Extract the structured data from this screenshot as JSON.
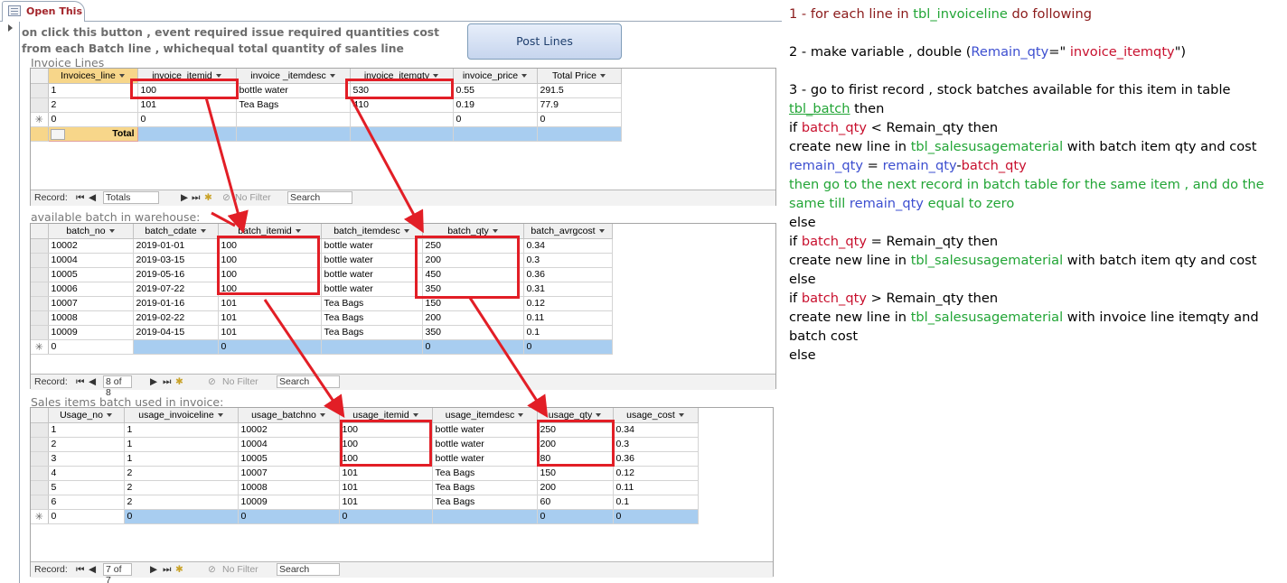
{
  "tab": {
    "label": "Open This"
  },
  "note": {
    "text": "on click this button , event required issue required quantities cost from each Batch line , whichequal total quantity of sales line"
  },
  "post_button": {
    "label": "Post Lines"
  },
  "invoice_lines": {
    "caption": "Invoice Lines",
    "columns": [
      "Invoices_line",
      "invoice_itemid",
      "invoice _itemdesc",
      "invoice_itemqty",
      "invoice_price",
      "Total Price"
    ],
    "rows": [
      [
        "1",
        "100",
        "bottle water",
        "530",
        "0.55",
        "291.5"
      ],
      [
        "2",
        "101",
        "Tea Bags",
        "410",
        "0.19",
        "77.9"
      ]
    ],
    "new_row": [
      "0",
      "0",
      "",
      "",
      "0",
      "0"
    ],
    "total_label": "Total",
    "nav": {
      "record_label": "Record:",
      "position": "Totals",
      "filter": "No Filter",
      "search": "Search"
    }
  },
  "batch": {
    "caption": "available batch in warehouse:",
    "columns": [
      "batch_no",
      "batch_cdate",
      "batch_itemid",
      "batch_itemdesc",
      "batch_qty",
      "batch_avrgcost"
    ],
    "rows": [
      [
        "10002",
        "2019-01-01",
        "100",
        "bottle water",
        "250",
        "0.34"
      ],
      [
        "10004",
        "2019-03-15",
        "100",
        "bottle water",
        "200",
        "0.3"
      ],
      [
        "10005",
        "2019-05-16",
        "100",
        "bottle water",
        "450",
        "0.36"
      ],
      [
        "10006",
        "2019-07-22",
        "100",
        "bottle water",
        "350",
        "0.31"
      ],
      [
        "10007",
        "2019-01-16",
        "101",
        "Tea Bags",
        "150",
        "0.12"
      ],
      [
        "10008",
        "2019-02-22",
        "101",
        "Tea Bags",
        "200",
        "0.11"
      ],
      [
        "10009",
        "2019-04-15",
        "101",
        "Tea Bags",
        "350",
        "0.1"
      ]
    ],
    "new_row": [
      "0",
      "",
      "0",
      "",
      "0",
      "0"
    ],
    "nav": {
      "record_label": "Record:",
      "position": "8 of 8",
      "filter": "No Filter",
      "search": "Search"
    }
  },
  "usage": {
    "caption": "Sales items batch used in invoice:",
    "columns": [
      "Usage_no",
      "usage_invoiceline",
      "usage_batchno",
      "usage_itemid",
      "usage_itemdesc",
      "usage_qty",
      "usage_cost"
    ],
    "rows": [
      [
        "1",
        "1",
        "10002",
        "100",
        "bottle water",
        "250",
        "0.34"
      ],
      [
        "2",
        "1",
        "10004",
        "100",
        "bottle water",
        "200",
        "0.3"
      ],
      [
        "3",
        "1",
        "10005",
        "100",
        "bottle water",
        "80",
        "0.36"
      ],
      [
        "4",
        "2",
        "10007",
        "101",
        "Tea Bags",
        "150",
        "0.12"
      ],
      [
        "5",
        "2",
        "10008",
        "101",
        "Tea Bags",
        "200",
        "0.11"
      ],
      [
        "6",
        "2",
        "10009",
        "101",
        "Tea Bags",
        "60",
        "0.1"
      ]
    ],
    "new_row": [
      "0",
      "0",
      "0",
      "0",
      "",
      "0",
      "0"
    ],
    "nav": {
      "record_label": "Record:",
      "position": "7 of 7",
      "filter": "No Filter",
      "search": "Search"
    }
  },
  "steps": {
    "s1_a": "1 - for each line in ",
    "s1_b": "tbl_invoiceline",
    "s1_c": " do following",
    "s2_a": "2 - make variable ,  double (",
    "s2_b": "Remain_qty",
    "s2_c": "=\" ",
    "s2_d": "invoice_itemqty",
    "s2_e": "\")",
    "s3_a": "3 - go to firist record , stock batches available for this item  in table",
    "s3_b": "tbl_batch",
    "s3_c": " then",
    "s3_d": "  if ",
    "s3_e": "batch_qty",
    "s3_f": " < Remain_qty then",
    "s3_g": "create new line in ",
    "s3_h": "tbl_salesusagematerial",
    "s3_i": " with batch item qty and cost",
    "s3_j": "remain_qty",
    "s3_k": " = ",
    "s3_l": "remain_qty",
    "s3_m": "-",
    "s3_n": "batch_qty",
    "s3_o": "then go to the next record in batch table for the same item , and do the same till ",
    "s3_p": "remain_qty",
    "s3_q": " equal to zero",
    "s3_r": "else",
    "s3_s": "if ",
    "s3_t": "batch_qty",
    "s3_u": " = Remain_qty then",
    "s3_v": "  create new line in ",
    "s3_w": "tbl_salesusagematerial",
    "s3_x": " with batch item qty and cost",
    "s3_y": "else",
    "s3_z": "if ",
    "s3_aa": "batch_qty",
    "s3_ab": " > Remain_qty then",
    "s3_ac": "  create new line in ",
    "s3_ad": "tbl_salesusagematerial",
    "s3_ae": " with invoice line itemqty and batch cost",
    "s3_af": "else"
  },
  "colors": {
    "annotation_red": "#e21e26",
    "access_blue": "#a8cdf0"
  }
}
